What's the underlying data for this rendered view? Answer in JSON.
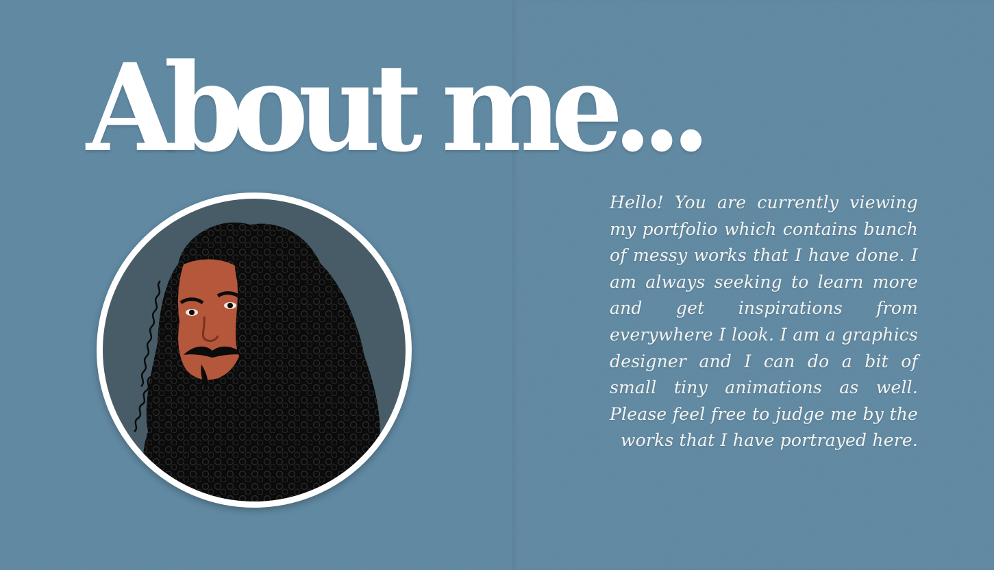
{
  "page": {
    "title": "About me...",
    "bio": "Hello! You are currently viewing my portfolio which contains bunch of messy works that I have done. I am always seeking to learn more and get inspirations from everywhere I look. I am a graphics designer and I can do a bit of small tiny animations as well. Please feel free to judge me by the works that I have portrayed here."
  },
  "avatar": {
    "icon": "portrait-illustration-icon"
  },
  "colors": {
    "background": "#5b86a1",
    "avatar_background": "#475c67",
    "frame": "#ffffff",
    "text": "#ffffff",
    "skin": "#b5573a",
    "hair": "#0b0b0b"
  }
}
